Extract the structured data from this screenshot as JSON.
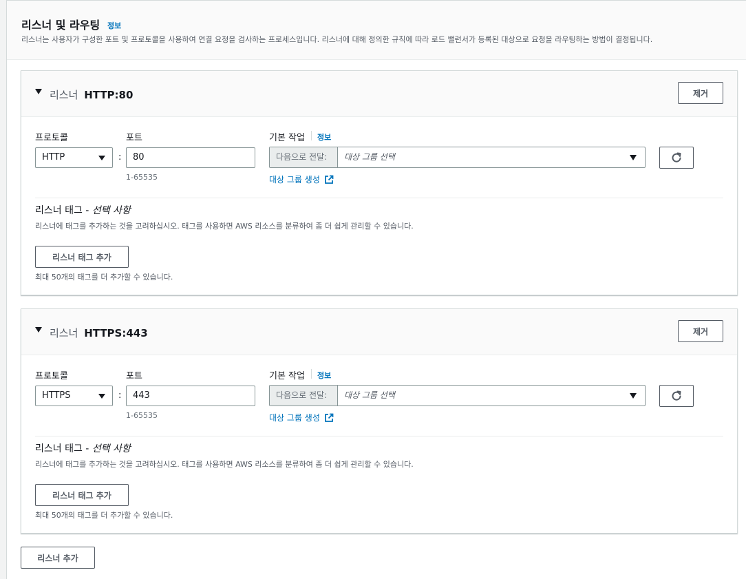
{
  "header": {
    "title": "리스너 및 라우팅",
    "info": "정보",
    "description": "리스너는 사용자가 구성한 포트 및 프로토콜을 사용하여 연결 요청을 검사하는 프로세스입니다. 리스너에 대해 정의한 규칙에 따라 로드 밸런서가 등록된 대상으로 요청을 라우팅하는 방법이 결정됩니다."
  },
  "listeners": [
    {
      "title_prefix": "리스너",
      "title_value": "HTTP:80",
      "remove_label": "제거",
      "protocol_label": "프로토콜",
      "protocol_value": "HTTP",
      "port_label": "포트",
      "port_value": "80",
      "port_hint": "1-65535",
      "action_label": "기본 작업",
      "action_info": "정보",
      "action_prefix": "다음으로 전달:",
      "action_placeholder": "대상 그룹 선택",
      "create_target_group": "대상 그룹 생성",
      "tag_title": "리스너 태그 -",
      "tag_title_optional": "선택 사항",
      "tag_description": "리스너에 태그를 추가하는 것을 고려하십시오. 태그를 사용하면 AWS 리소스를 분류하여 좀 더 쉽게 관리할 수 있습니다.",
      "add_tag_label": "리스너 태그 추가",
      "tag_limit": "최대 50개의 태그를 더 추가할 수 있습니다."
    },
    {
      "title_prefix": "리스너",
      "title_value": "HTTPS:443",
      "remove_label": "제거",
      "protocol_label": "프로토콜",
      "protocol_value": "HTTPS",
      "port_label": "포트",
      "port_value": "443",
      "port_hint": "1-65535",
      "action_label": "기본 작업",
      "action_info": "정보",
      "action_prefix": "다음으로 전달:",
      "action_placeholder": "대상 그룹 선택",
      "create_target_group": "대상 그룹 생성",
      "tag_title": "리스너 태그 -",
      "tag_title_optional": "선택 사항",
      "tag_description": "리스너에 태그를 추가하는 것을 고려하십시오. 태그를 사용하면 AWS 리소스를 분류하여 좀 더 쉽게 관리할 수 있습니다.",
      "add_tag_label": "리스너 태그 추가",
      "tag_limit": "최대 50개의 태그를 더 추가할 수 있습니다."
    }
  ],
  "add_listener_label": "리스너 추가",
  "icons": {
    "refresh": "refresh-icon",
    "external_link": "external-link-icon",
    "expand_caret": "caret-down-icon"
  },
  "colors": {
    "link": "#0073bb",
    "border": "#879596",
    "text": "#16191f",
    "muted": "#545b64"
  }
}
